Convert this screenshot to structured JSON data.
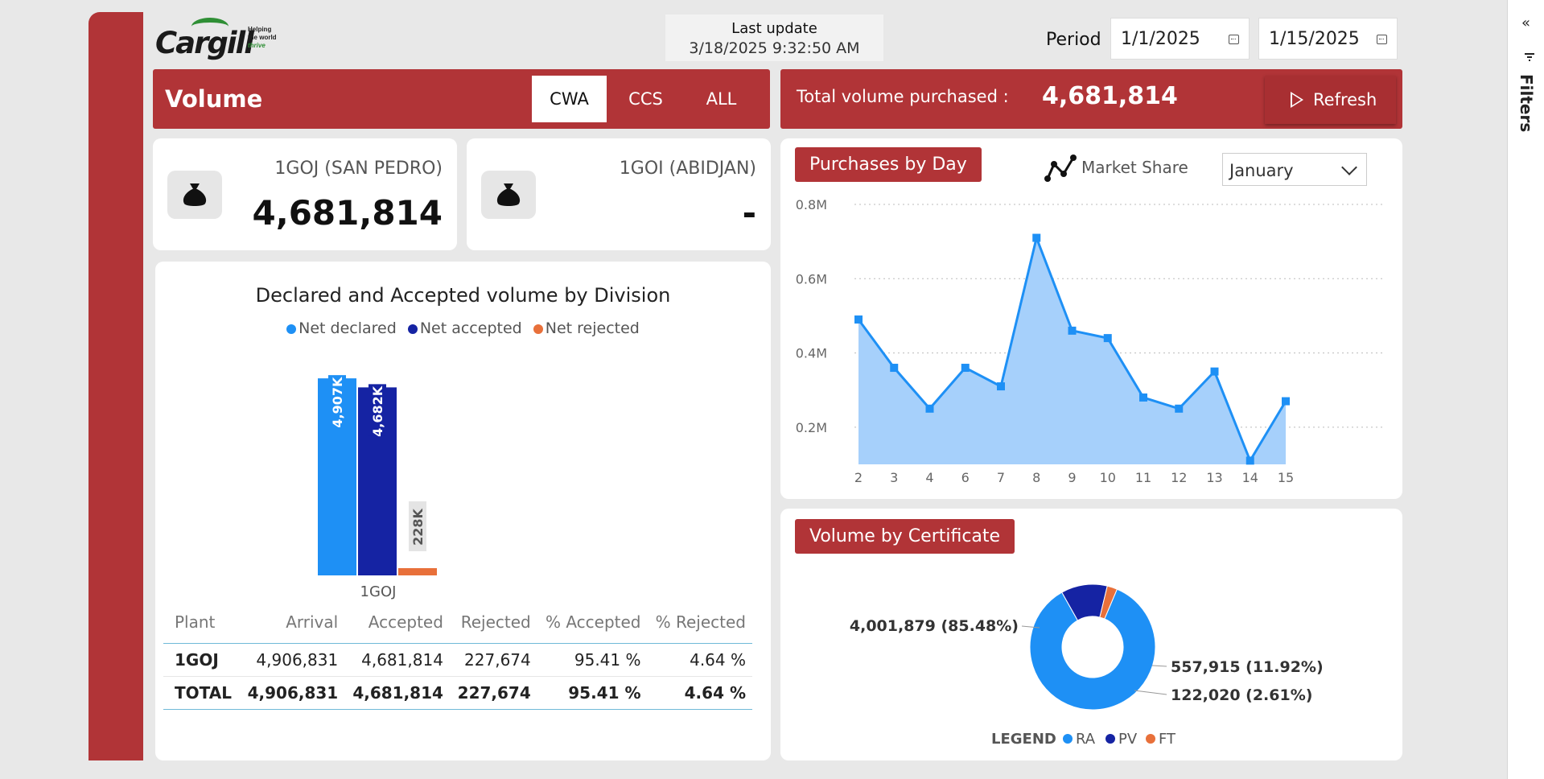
{
  "header": {
    "logo": {
      "word": "Cargill",
      "tag_line1": "Helping",
      "tag_line2": "the world",
      "tag_line3": "thrive"
    },
    "last_update_label": "Last update",
    "last_update_value": "3/18/2025 9:32:50 AM",
    "period_label": "Period",
    "period_start": "1/1/2025",
    "period_end": "1/15/2025"
  },
  "volume_bar": {
    "title": "Volume",
    "tabs": [
      {
        "label": "CWA",
        "active": true
      },
      {
        "label": "CCS",
        "active": false
      },
      {
        "label": "ALL",
        "active": false
      }
    ]
  },
  "total_bar": {
    "label": "Total volume purchased :",
    "value": "4,681,814",
    "refresh_label": "Refresh"
  },
  "plant_cards": [
    {
      "label": "1GOJ (SAN PEDRO)",
      "value": "4,681,814",
      "icon": "money-bag-icon"
    },
    {
      "label": "1GOI (ABIDJAN)",
      "value": "-",
      "icon": "money-bag-icon"
    }
  ],
  "division_chart": {
    "title": "Declared and Accepted volume by Division",
    "legend": [
      {
        "name": "Net declared",
        "color": "#1e90f5"
      },
      {
        "name": "Net accepted",
        "color": "#1523a3"
      },
      {
        "name": "Net rejected",
        "color": "#e8703a"
      }
    ]
  },
  "plant_table": {
    "columns": [
      "Plant",
      "Arrival",
      "Accepted",
      "Rejected",
      "% Accepted",
      "% Rejected"
    ],
    "rows": [
      [
        "1GOJ",
        "4,906,831",
        "4,681,814",
        "227,674",
        "95.41 %",
        "4.64 %"
      ]
    ],
    "total": [
      "TOTAL",
      "4,906,831",
      "4,681,814",
      "227,674",
      "95.41 %",
      "4.64 %"
    ]
  },
  "purchases": {
    "title": "Purchases by Day",
    "market_share_label": "Market Share",
    "market_share_icon": "line-scatter-icon",
    "month_value": "January"
  },
  "certificate": {
    "title": "Volume by Certificate",
    "legend_title": "LEGEND"
  },
  "side_panel": {
    "collapse_glyph": "«",
    "filters_label": "Filters"
  },
  "colors": {
    "brand_red": "#b13437",
    "accent_blue": "#1e90f5",
    "dark_blue": "#1523a3",
    "orange": "#e8703a",
    "area_fill": "#a6d0fb"
  },
  "chart_data": [
    {
      "type": "bar",
      "title": "Declared and Accepted volume by Division",
      "categories": [
        "1GOJ"
      ],
      "series": [
        {
          "name": "Net declared",
          "values": [
            4906831
          ],
          "label": "4,907K"
        },
        {
          "name": "Net accepted",
          "values": [
            4681814
          ],
          "label": "4,682K"
        },
        {
          "name": "Net rejected",
          "values": [
            227674
          ],
          "label": "228K"
        }
      ],
      "ylim": [
        0,
        5500000
      ],
      "legend": "top-center",
      "grid": false
    },
    {
      "type": "area",
      "title": "Purchases by Day",
      "x": [
        2,
        3,
        4,
        6,
        7,
        8,
        9,
        10,
        11,
        12,
        13,
        14,
        15
      ],
      "values": [
        0.49,
        0.36,
        0.25,
        0.36,
        0.31,
        0.71,
        0.46,
        0.44,
        0.28,
        0.25,
        0.35,
        0.11,
        0.27
      ],
      "y_unit": "M",
      "yticks": [
        "0.2M",
        "0.4M",
        "0.6M",
        "0.8M"
      ],
      "ylim": [
        0.1,
        0.8
      ],
      "grid": true
    },
    {
      "type": "pie",
      "title": "Volume by Certificate",
      "labels": [
        "RA",
        "PV",
        "FT"
      ],
      "values": [
        4001879,
        557915,
        122020
      ],
      "data_labels": [
        "4,001,879 (85.48%)",
        "557,915 (11.92%)",
        "122,020 (2.61%)"
      ],
      "colors": [
        "#1e90f5",
        "#1523a3",
        "#e8703a"
      ],
      "legend": "bottom"
    }
  ]
}
